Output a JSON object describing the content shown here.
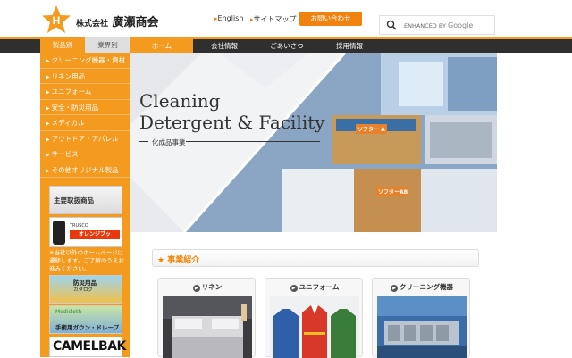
{
  "header": {
    "company_prefix": "株式会社",
    "company_name": "廣瀬商会",
    "links": [
      "English",
      "サイトマップ"
    ],
    "contact_button": "お問い合わせ",
    "search_placeholder_small": "ENHANCED BY",
    "search_placeholder_google": "Google"
  },
  "nav": {
    "category_tabs": [
      "製品別",
      "業界別"
    ],
    "items": [
      "ホーム",
      "会社情報",
      "ごあいさつ",
      "採用情報"
    ],
    "active": "ホーム"
  },
  "sidebar": {
    "items": [
      "クリーニング機器・資材",
      "リネン用品",
      "ユニフォーム",
      "安全・防災用品",
      "メディカル",
      "アウトドア・アパレル",
      "サービス",
      "その他オリジナル製品"
    ],
    "banner_main_products": "主要取扱商品",
    "banner_trusco": "TRUSCO",
    "banner_orange_book": "オレンジブック.com",
    "note": "※当社以外のホームページに遷移します。ご了解のうえお進みください。",
    "banner_disaster": "防災用品",
    "banner_disaster_sub": "カタログ",
    "banner_medicloth_brand": "Medicloth",
    "banner_medicloth": "手術用ガウン・ドレープ",
    "banner_camelbak": "CAMELBAK"
  },
  "hero": {
    "title_line1": "Cleaning",
    "title_line2": "Detergent & Facility",
    "subtitle": "化成品事業",
    "box_label_1": "ソフター A",
    "box_label_2": "ソフターAB"
  },
  "section": {
    "title": "★ 事業紹介",
    "cards": [
      "リネン",
      "ユニフォーム",
      "クリーニング機器"
    ]
  },
  "colors": {
    "accent": "#f39a1f",
    "nav_bg": "#2f2f2f",
    "section_title": "#f08300"
  }
}
